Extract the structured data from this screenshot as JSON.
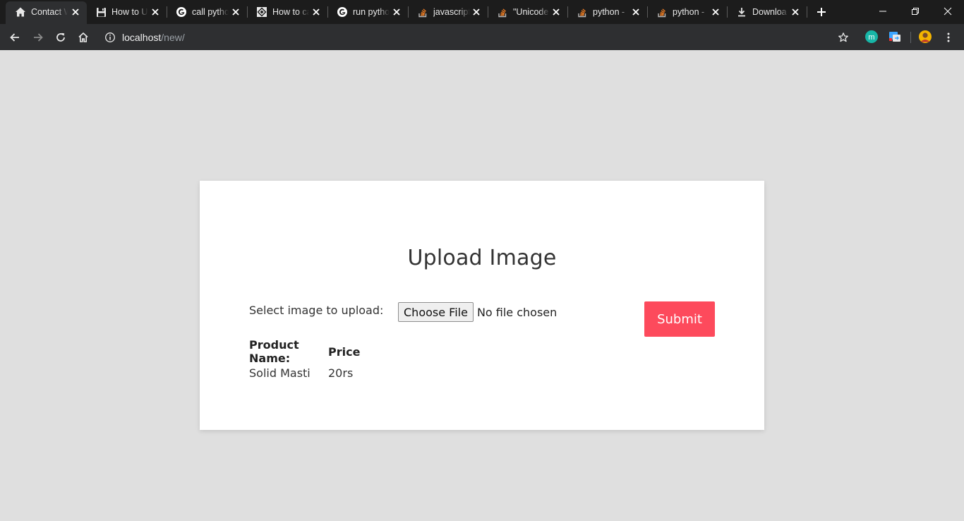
{
  "browser": {
    "tabs": [
      {
        "title": "Contact W",
        "icon": "home-icon",
        "active": true
      },
      {
        "title": "How to U",
        "icon": "floppy-icon",
        "active": false
      },
      {
        "title": "call pytho",
        "icon": "google-icon",
        "active": false
      },
      {
        "title": "How to ca",
        "icon": "diamond-icon",
        "active": false
      },
      {
        "title": "run pytho",
        "icon": "google-icon",
        "active": false
      },
      {
        "title": "javascript",
        "icon": "stackoverflow-icon",
        "active": false
      },
      {
        "title": "\"Unicode",
        "icon": "stackoverflow-icon",
        "active": false
      },
      {
        "title": "python -",
        "icon": "stackoverflow-icon",
        "active": false
      },
      {
        "title": "python -",
        "icon": "stackoverflow-icon",
        "active": false
      },
      {
        "title": "Downloa",
        "icon": "download-icon",
        "active": false
      }
    ],
    "url": {
      "host": "localhost",
      "path": "/new/"
    },
    "colors": {
      "tabstrip": "#1c1c1c",
      "toolbar": "#2e2f31",
      "stackoverflow": "#f48024"
    }
  },
  "page": {
    "title": "Upload Image",
    "file_label": "Select image to upload:",
    "choose_file": "Choose File",
    "file_status": "No file chosen",
    "submit": "Submit",
    "table": {
      "headers": [
        "Product Name:",
        "Price"
      ],
      "rows": [
        [
          "Solid Masti",
          "20rs"
        ]
      ]
    },
    "colors": {
      "background": "#dfdfdf",
      "card": "#ffffff",
      "submit": "#fd4a5c"
    }
  }
}
